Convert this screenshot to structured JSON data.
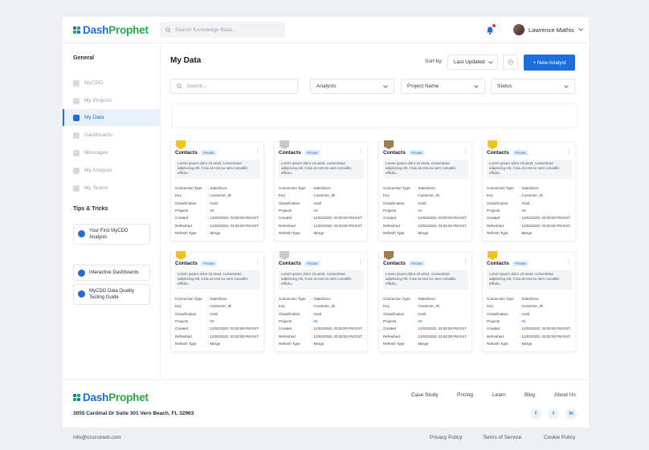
{
  "brand": {
    "name_part1": "Dash",
    "name_part2": "Prophet",
    "blue": "#1f6fd1",
    "green": "#27a844"
  },
  "header": {
    "search_placeholder": "Search Knowledge Base...",
    "user_name": "Lawrence Mathis",
    "notification_icon": "bell-icon"
  },
  "sidebar": {
    "general_title": "General",
    "items": [
      {
        "label": "MyCDO",
        "icon": "home-icon"
      },
      {
        "label": "My Projects",
        "icon": "folder-icon"
      },
      {
        "label": "My Data",
        "icon": "data-icon",
        "active": true
      },
      {
        "label": "Dashboards",
        "icon": "dashboard-icon"
      },
      {
        "label": "Messages",
        "icon": "message-icon"
      },
      {
        "label": "My Analysts",
        "icon": "analyst-icon"
      },
      {
        "label": "My Teams",
        "icon": "team-icon"
      }
    ],
    "tips_title": "Tips & Tricks",
    "tips": [
      {
        "label": "Your First MyCDO Analysis"
      },
      {
        "label": "Interactive Dashboards"
      },
      {
        "label": "MyCDO Data Quality Testing Guide"
      }
    ]
  },
  "main": {
    "title": "My Data",
    "sort_label": "Sort by:",
    "sort_value": "Last Updated",
    "new_button": "+ New Analyst",
    "search_placeholder": "Search...",
    "filters": [
      "Analysts",
      "Project Name",
      "Status"
    ]
  },
  "card_labels": {
    "connection_type": "Connection Type",
    "key": "Key",
    "classification": "Classification",
    "projects": "Projects",
    "created": "Created",
    "refreshed": "Refreshed",
    "refresh_type": "Refresh Type"
  },
  "cards": [
    {
      "title": "Contacts",
      "tag": "Private",
      "badge": "gold",
      "description": "Lorem ipsum dolor sit amet, consectetur adipiscing elit. Cras at erat eu sem convallis efficitu.",
      "connection_type": ": Salesforce",
      "key": ": Customer_ID",
      "classification": ": Gold",
      "projects": ": 08",
      "created": ": 12/02/2020, 03:00:00 PM EST",
      "refreshed": ": 12/02/2020, 03:00:00 PM EST",
      "refresh_type": ": Merge"
    },
    {
      "title": "Contacts",
      "tag": "Private",
      "badge": "silver",
      "description": "Lorem ipsum dolor sit amet, consectetur adipiscing elit. Cras at erat eu sem convallis efficitu.",
      "connection_type": ": Salesforce",
      "key": ": Customer_ID",
      "classification": ": Gold",
      "projects": ": 08",
      "created": ": 12/02/2020, 03:00:00 PM EST",
      "refreshed": ": 12/02/2020, 03:00:00 PM EST",
      "refresh_type": ": Merge"
    },
    {
      "title": "Contacts",
      "tag": "Private",
      "badge": "bronze",
      "description": "Lorem ipsum dolor sit amet, consectetur adipiscing elit. Cras at erat eu sem convallis efficitu.",
      "connection_type": ": Salesforce",
      "key": ": Customer_ID",
      "classification": ": Gold",
      "projects": ": 08",
      "created": ": 12/02/2020, 03:00:00 PM EST",
      "refreshed": ": 12/02/2020, 03:00:00 PM EST",
      "refresh_type": ": Merge"
    },
    {
      "title": "Contacts",
      "tag": "Private",
      "badge": "gold",
      "description": "Lorem ipsum dolor sit amet, consectetur adipiscing elit. Cras at erat eu sem convallis efficitu.",
      "connection_type": ": Salesforce",
      "key": ": Customer_ID",
      "classification": ": Gold",
      "projects": ": 08",
      "created": ": 12/02/2020, 03:00:00 PM EST",
      "refreshed": ": 12/02/2020, 03:00:00 PM EST",
      "refresh_type": ": Merge"
    },
    {
      "title": "Contacts",
      "tag": "Private",
      "badge": "gold",
      "description": "Lorem ipsum dolor sit amet, consectetur adipiscing elit. Cras at erat eu sem convallis efficitu.",
      "connection_type": ": Salesforce",
      "key": ": Customer_ID",
      "classification": ": Gold",
      "projects": ": 08",
      "created": ": 12/02/2020, 03:00:00 PM EST",
      "refreshed": ": 12/02/2020, 03:00:00 PM EST",
      "refresh_type": ": Merge"
    },
    {
      "title": "Contacts",
      "tag": "Private",
      "badge": "silver",
      "description": "Lorem ipsum dolor sit amet, consectetur adipiscing elit. Cras at erat eu sem convallis efficitu.",
      "connection_type": ": Salesforce",
      "key": ": Customer_ID",
      "classification": ": Gold",
      "projects": ": 08",
      "created": ": 12/02/2020, 03:00:00 PM EST",
      "refreshed": ": 12/02/2020, 03:00:00 PM EST",
      "refresh_type": ": Merge"
    },
    {
      "title": "Contacts",
      "tag": "Private",
      "badge": "bronze",
      "description": "Lorem ipsum dolor sit amet, consectetur adipiscing elit. Cras at erat eu sem convallis efficitu.",
      "connection_type": ": Salesforce",
      "key": ": Customer_ID",
      "classification": ": Gold",
      "projects": ": 08",
      "created": ": 12/02/2020, 03:00:00 PM EST",
      "refreshed": ": 12/02/2020, 03:00:00 PM EST",
      "refresh_type": ": Merge"
    },
    {
      "title": "Contacts",
      "tag": "Private",
      "badge": "gold",
      "description": "Lorem ipsum dolor sit amet, consectetur adipiscing elit. Cras at erat eu sem convallis efficitu.",
      "connection_type": ": Salesforce",
      "key": ": Customer_ID",
      "classification": ": Gold",
      "projects": ": 08",
      "created": ": 12/02/2020, 03:00:00 PM EST",
      "refreshed": ": 12/02/2020, 03:00:00 PM EST",
      "refresh_type": ": Merge"
    }
  ],
  "badge_colors": {
    "gold": "#f4c21b",
    "silver": "#c5c9d0",
    "bronze": "#a27a4c"
  },
  "footer": {
    "address": "3055 Cardinal Dr Suite 301 Vero Beach, FL 32963",
    "links": [
      "Case Study",
      "Pricing",
      "Learn",
      "Blog",
      "About Us"
    ],
    "social": [
      "facebook-icon",
      "twitter-icon",
      "linkedin-icon"
    ],
    "email": "info@cruzstreet.com",
    "legal": [
      "Privacy Policy",
      "Terms of Service",
      "Cookie Policy"
    ]
  }
}
